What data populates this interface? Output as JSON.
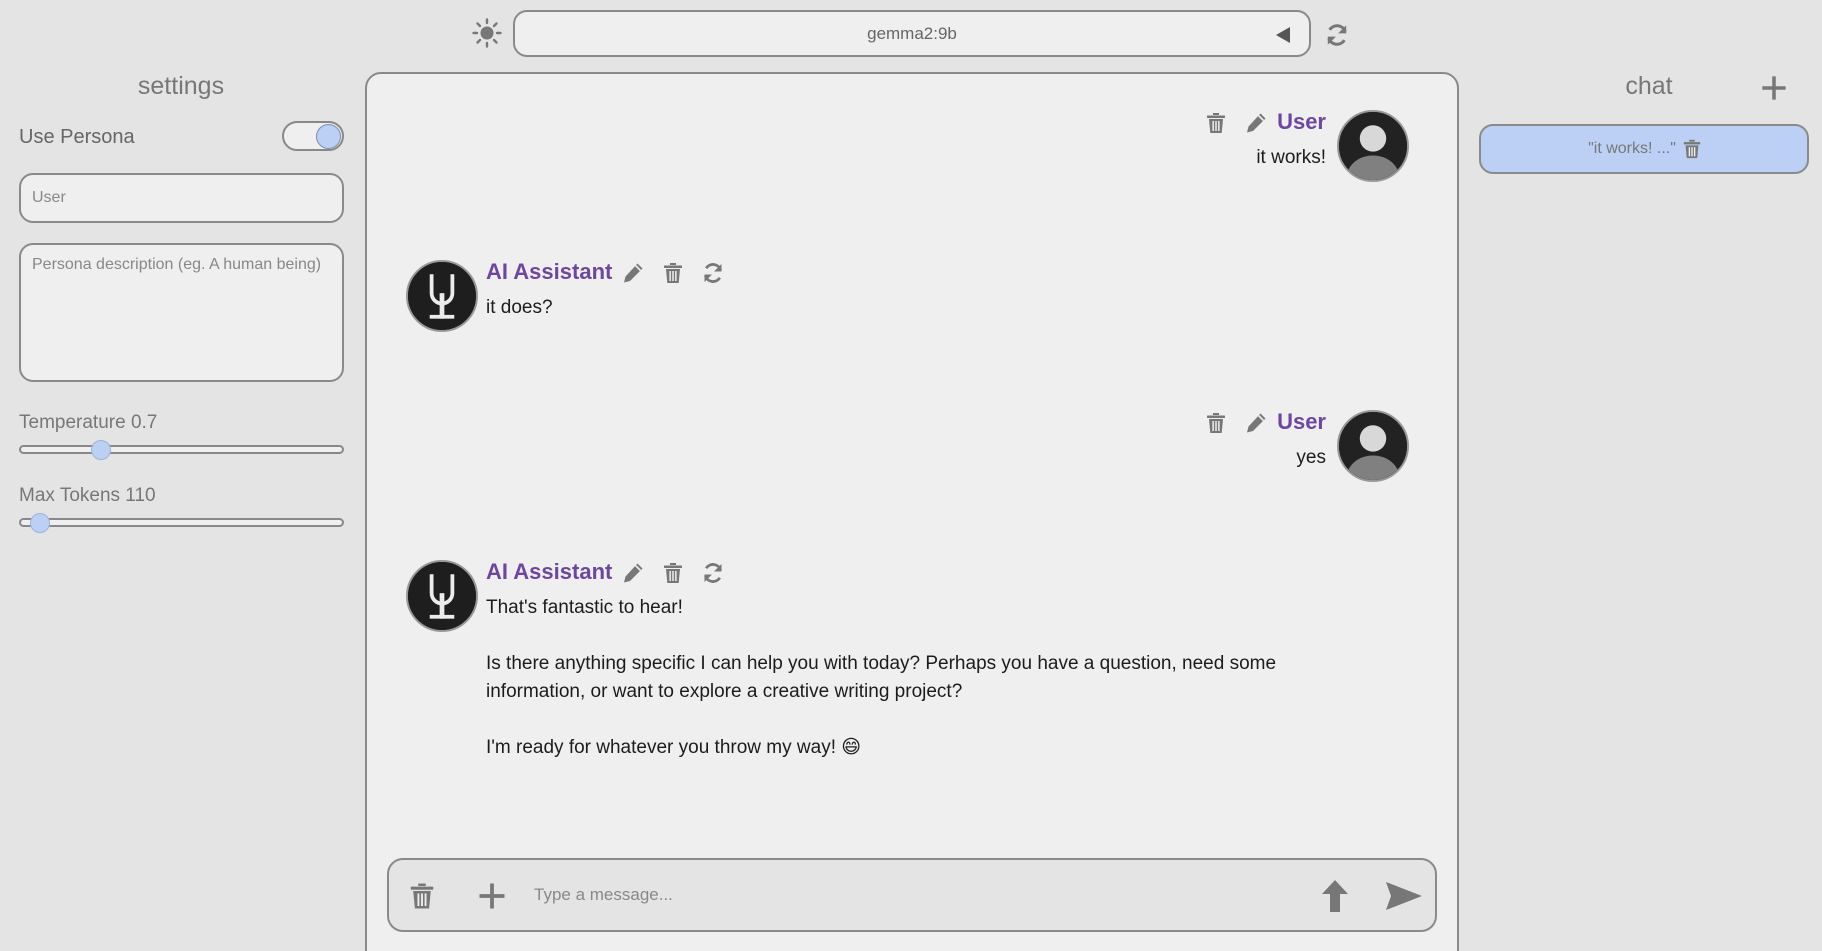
{
  "topbar": {
    "theme_icon": "sun-icon",
    "model": "gemma2:9b",
    "model_arrow_icon": "triangle-left-icon",
    "refresh_icon": "refresh-icon"
  },
  "settings": {
    "title": "settings",
    "use_persona_label": "Use Persona",
    "use_persona_enabled": true,
    "name_placeholder": "User",
    "name_value": "",
    "persona_placeholder": "Persona description (eg. A human being)",
    "persona_value": "",
    "temperature_label": "Temperature 0.7",
    "temperature_fraction": 0.25,
    "max_tokens_label": "Max Tokens 110",
    "max_tokens_fraction": 0.06
  },
  "messages": [
    {
      "role": "user",
      "name": "User",
      "text": "it works!"
    },
    {
      "role": "assistant",
      "name": "AI Assistant",
      "text": "it does?"
    },
    {
      "role": "user",
      "name": "User",
      "text": "yes"
    },
    {
      "role": "assistant",
      "name": "AI Assistant",
      "paragraphs": [
        "That's fantastic to hear!",
        "Is there anything specific I can help you with today? Perhaps you have a question, need some information, or want to explore a creative writing project?",
        "I'm ready for whatever you throw my way! 😄"
      ]
    }
  ],
  "composer": {
    "placeholder": "Type a message...",
    "value": "",
    "icons": [
      "trash-icon",
      "plus-icon",
      "arrow-up-icon",
      "send-icon"
    ]
  },
  "chats": {
    "title": "chat",
    "new_chat_icon": "plus-icon",
    "items": [
      {
        "label": "\"it works! ...\""
      }
    ]
  },
  "colors": {
    "background": "#e4e4e4",
    "panel": "#efefef",
    "border": "#8a8a8a",
    "accent": "#bcd0f5",
    "name": "#6e46a0",
    "icon": "#777777"
  }
}
